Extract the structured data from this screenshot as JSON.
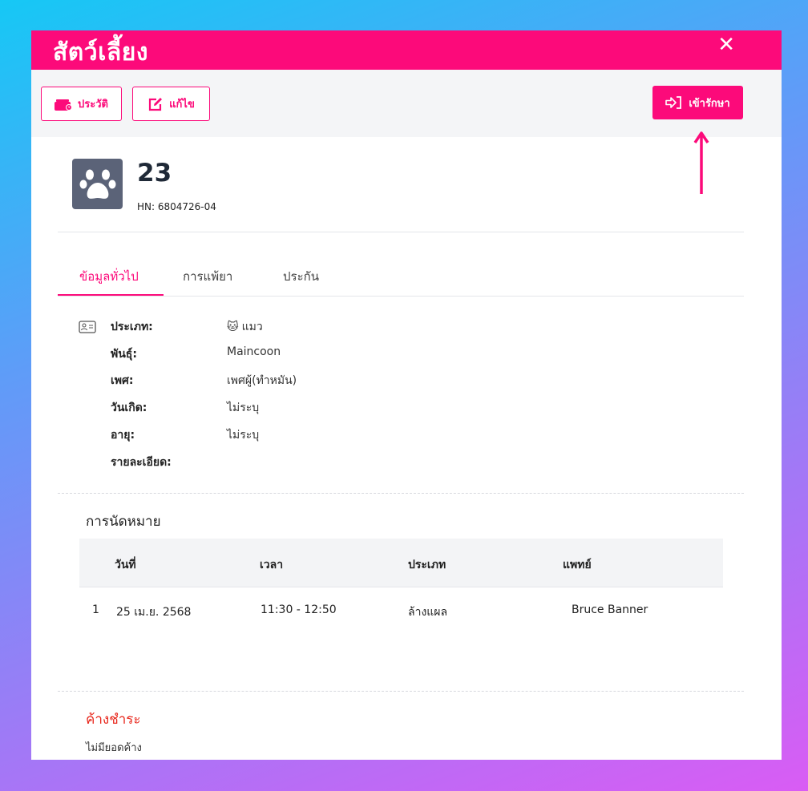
{
  "modal": {
    "title": "สัตว์เลี้ยง",
    "close_label": "✕"
  },
  "toolbar": {
    "history_label": "ประวัติ",
    "edit_label": "แก้ไข",
    "admit_label": "เข้ารักษา"
  },
  "pet": {
    "name": "23",
    "hn": "HN: 6804726-04"
  },
  "tabs": [
    {
      "label": "ข้อมูลทั่วไป",
      "active": true
    },
    {
      "label": "การแพ้ยา",
      "active": false
    },
    {
      "label": "ประกัน",
      "active": false
    }
  ],
  "info": {
    "type_label": "ประเภท:",
    "type_value": "แมว",
    "breed_label": "พันธุ์:",
    "breed_value": "Maincoon",
    "sex_label": "เพศ:",
    "sex_value": "เพศผู้(ทำหมัน)",
    "birth_label": "วันเกิด:",
    "birth_value": "ไม่ระบุ",
    "age_label": "อายุ:",
    "age_value": "ไม่ระบุ",
    "detail_label": "รายละเอียด:"
  },
  "appointments": {
    "title": "การนัดหมาย",
    "columns": [
      "วันที่",
      "เวลา",
      "ประเภท",
      "แพทย์"
    ],
    "rows": [
      {
        "no": "1",
        "date": "25 เม.ย. 2568",
        "time": "11:30 - 12:50",
        "type": "ล้างแผล",
        "doctor": "Bruce Banner"
      }
    ]
  },
  "outstanding": {
    "title": "ค้างชำระ",
    "text": "ไม่มียอดค้าง"
  },
  "colors": {
    "brand": "#fc0a7a",
    "danger": "#e8271c"
  }
}
